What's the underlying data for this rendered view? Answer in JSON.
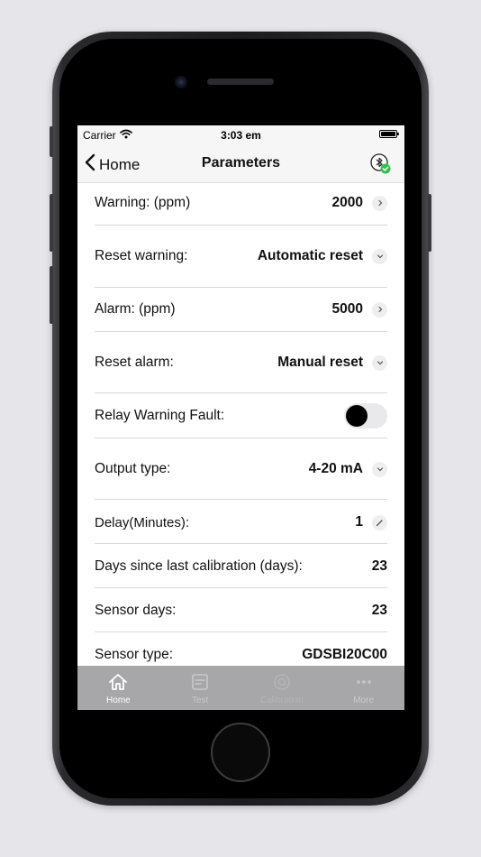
{
  "status_bar": {
    "carrier": "Carrier",
    "time": "3:03 em"
  },
  "nav": {
    "back_label": "Home",
    "title": "Parameters",
    "action_icon": "bluetooth-connected-icon"
  },
  "rows": [
    {
      "label": "Warning: (ppm)",
      "value": "2000",
      "control": "chevron-right-icon"
    },
    {
      "label": "Reset warning:",
      "value": "Automatic reset",
      "control": "chevron-down-icon"
    },
    {
      "label": "Alarm: (ppm)",
      "value": "5000",
      "control": "chevron-right-icon"
    },
    {
      "label": "Reset alarm:",
      "value": "Manual reset",
      "control": "chevron-down-icon"
    },
    {
      "label": "Relay Warning Fault:",
      "toggle_on": false
    },
    {
      "label": "Output type:",
      "value": "4-20 mA",
      "control": "chevron-down-icon"
    },
    {
      "label": "Delay(Minutes):",
      "value": "1",
      "control": "pencil-icon"
    },
    {
      "label": "Days since last calibration (days):",
      "value": "23"
    },
    {
      "label": "Sensor days:",
      "value": "23"
    },
    {
      "label": "Sensor type:",
      "value": "GDSBI20C00"
    }
  ],
  "tabs": [
    {
      "label": "Home",
      "icon": "home-icon",
      "state": "active"
    },
    {
      "label": "Test",
      "icon": "test-icon",
      "state": "dim"
    },
    {
      "label": "Calibration",
      "icon": "calibration-icon",
      "state": "faint"
    },
    {
      "label": "More",
      "icon": "more-icon",
      "state": "dim"
    }
  ],
  "colors": {
    "accent_green": "#2ec14a",
    "tab_bar": "#a7a7aa",
    "nav_bg": "#f6f6f6"
  }
}
